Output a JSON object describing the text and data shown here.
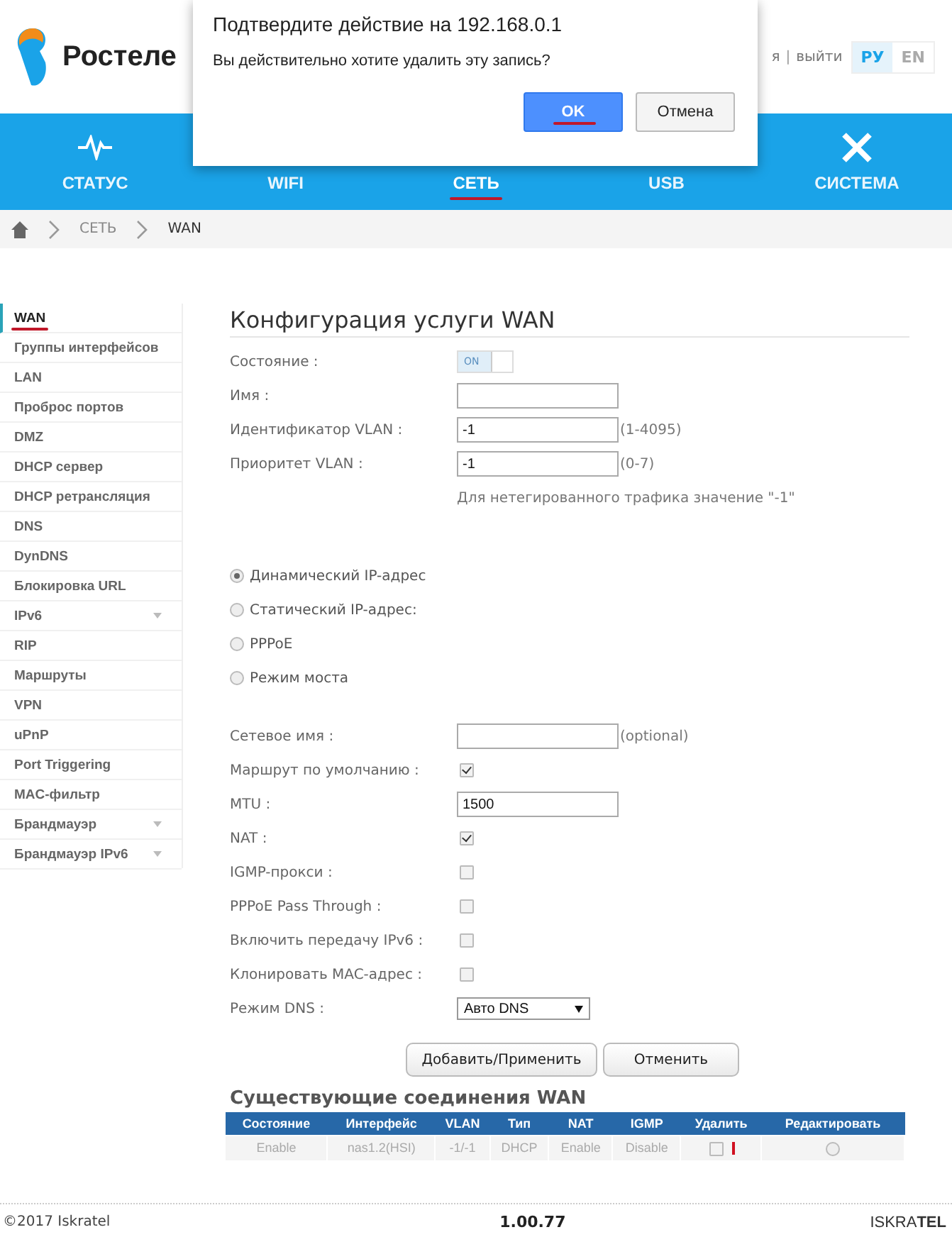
{
  "header": {
    "logo_text": "Ростеле",
    "user_links": [
      {
        "label": "я"
      },
      {
        "label": "выйти"
      }
    ],
    "separator": "|",
    "languages": [
      {
        "label": "РУ",
        "selected": true
      },
      {
        "label": "EN",
        "selected": false
      }
    ]
  },
  "nav": [
    {
      "label": "СТАТУС",
      "selected": false,
      "underlined": false
    },
    {
      "label": "WIFI",
      "selected": false,
      "underlined": false
    },
    {
      "label": "СЕТЬ",
      "selected": true,
      "underlined": true
    },
    {
      "label": "USB",
      "selected": false,
      "underlined": false
    },
    {
      "label": "СИСТЕМА",
      "selected": false,
      "underlined": false
    }
  ],
  "breadcrumb": [
    "СЕТЬ",
    "WAN"
  ],
  "sidebar": {
    "items": [
      {
        "label": "WAN",
        "selected": true,
        "underlined": true
      },
      {
        "label": "Группы интерфейсов",
        "selected": false
      },
      {
        "label": "LAN",
        "selected": false
      },
      {
        "label": "Проброс портов",
        "selected": false
      },
      {
        "label": "DMZ",
        "selected": false
      },
      {
        "label": "DHCP сервер",
        "selected": false
      },
      {
        "label": "DHCP ретрансляция",
        "selected": false
      },
      {
        "label": "DNS",
        "selected": false
      },
      {
        "label": "DynDNS",
        "selected": false
      },
      {
        "label": "Блокировка URL",
        "selected": false
      },
      {
        "label": "IPv6",
        "selected": false,
        "expandable": true
      },
      {
        "label": "RIP",
        "selected": false
      },
      {
        "label": "Маршруты",
        "selected": false
      },
      {
        "label": "VPN",
        "selected": false
      },
      {
        "label": "uPnP",
        "selected": false
      },
      {
        "label": "Port Triggering",
        "selected": false
      },
      {
        "label": "MAC-фильтр",
        "selected": false
      },
      {
        "label": "Брандмауэр",
        "selected": false,
        "expandable": true
      },
      {
        "label": "Брандмауэр IPv6",
        "selected": false,
        "expandable": true
      }
    ]
  },
  "form": {
    "title": "Конфигурация услуги WAN",
    "fields": [
      {
        "kind": "toggle",
        "label": "Состояние :",
        "on": true,
        "text": "ON"
      },
      {
        "kind": "text",
        "label": "Имя :"
      },
      {
        "kind": "text",
        "label": "Идентификатор VLAN :",
        "value": "-1",
        "hint": "(1-4095)"
      },
      {
        "kind": "text",
        "label": "Приоритет VLAN :",
        "value": "-1",
        "hint": "(0-7)"
      },
      {
        "kind": "note",
        "text": "Для нетегированного трафика значение \"-1\""
      }
    ],
    "connection_types": [
      {
        "label": "Динамический IP-адрес",
        "selected": true
      },
      {
        "label": "Статический IP-адрес:",
        "selected": false
      },
      {
        "label": "PPPoE",
        "selected": false
      },
      {
        "label": "Режим моста",
        "selected": false
      }
    ],
    "fields2": [
      {
        "kind": "text",
        "label": "Сетевое имя :",
        "hint": "(optional)"
      },
      {
        "kind": "checkbox",
        "label": "Маршрут по умолчанию :",
        "checked": true
      },
      {
        "kind": "text",
        "label": "MTU :",
        "value": "1500"
      },
      {
        "kind": "checkbox",
        "label": "NAT :",
        "checked": true
      },
      {
        "kind": "checkbox",
        "label": "IGMP-прокси :",
        "checked": false
      },
      {
        "kind": "checkbox",
        "label": "PPPoE Pass Through :",
        "checked": false
      },
      {
        "kind": "checkbox",
        "label": "Включить передачу IPv6 :",
        "checked": false
      },
      {
        "kind": "checkbox",
        "label": "Клонировать MAC-адрес :",
        "checked": false
      },
      {
        "kind": "select",
        "label": "Режим DNS :",
        "value": "Авто DNS"
      }
    ],
    "buttons": [
      "Добавить/Применить",
      "Отменить"
    ]
  },
  "connections": {
    "title": "Существующие соединения WAN",
    "columns": [
      "Состояние",
      "Интерфейс",
      "VLAN",
      "Тип",
      "NAT",
      "IGMP",
      "Удалить",
      "Редактировать"
    ],
    "rows": [
      {
        "cells": [
          "Enable",
          "nas1.2(HSI)",
          "-1/-1",
          "DHCP",
          "Enable",
          "Disable"
        ],
        "delete_checked": false,
        "delete_marked": true,
        "edit_selected": false
      }
    ]
  },
  "footer": {
    "copyright": "©2017 Iskratel",
    "version": "1.00.77",
    "brand": "ISKRA**TEL**"
  },
  "dialog": {
    "title": "Подтвердите действие на 192.168.0.1",
    "message": "Вы действительно хотите удалить эту запись?",
    "buttons": [
      {
        "label": "OK",
        "primary": true,
        "underlined": true
      },
      {
        "label": "Отмена",
        "primary": false,
        "underlined": false
      }
    ]
  }
}
